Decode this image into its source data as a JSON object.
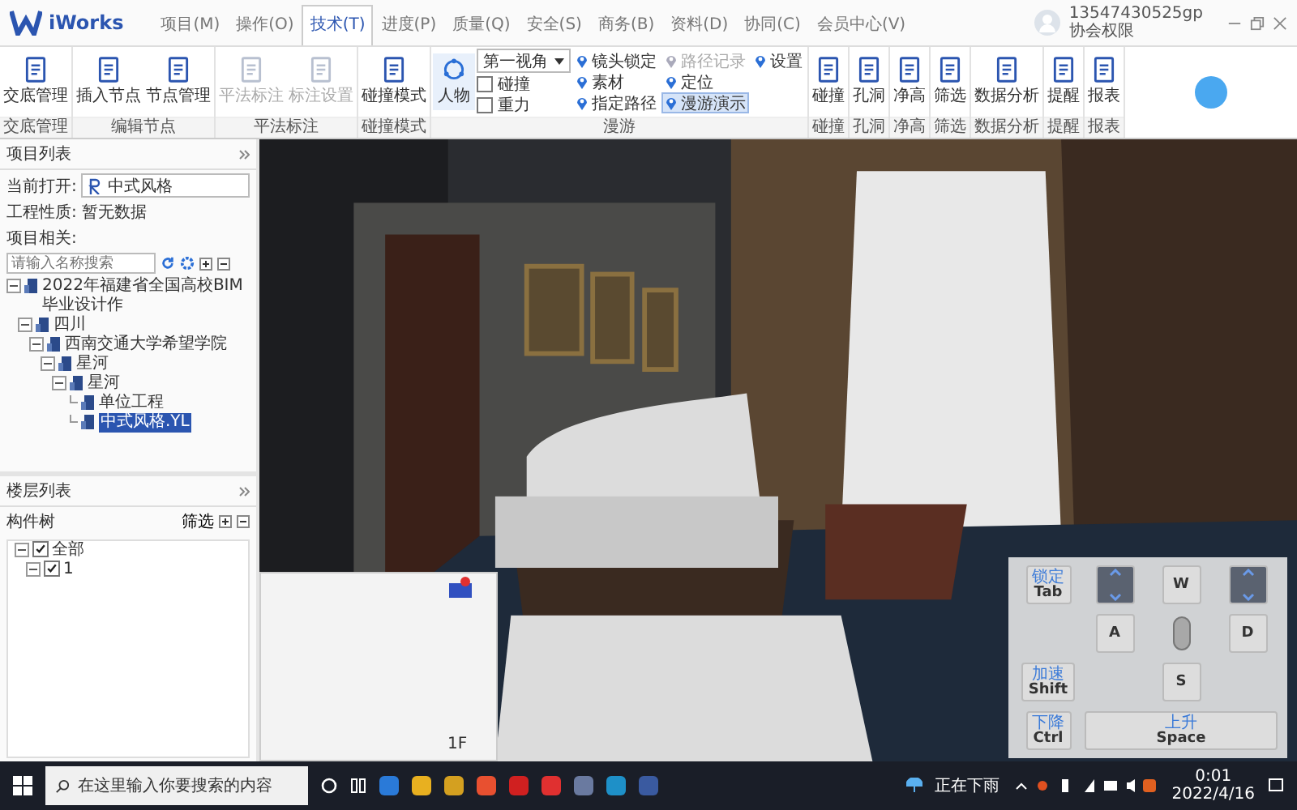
{
  "app": {
    "name": "iWorks"
  },
  "menu_tabs": [
    {
      "label": "项目(M)",
      "selected": false
    },
    {
      "label": "操作(O)",
      "selected": false
    },
    {
      "label": "技术(T)",
      "selected": true
    },
    {
      "label": "进度(P)",
      "selected": false
    },
    {
      "label": "质量(Q)",
      "selected": false
    },
    {
      "label": "安全(S)",
      "selected": false
    },
    {
      "label": "商务(B)",
      "selected": false
    },
    {
      "label": "资料(D)",
      "selected": false
    },
    {
      "label": "协同(C)",
      "selected": false
    },
    {
      "label": "会员中心(V)",
      "selected": false
    }
  ],
  "user": {
    "account": "13547430525gp",
    "role": "协会权限"
  },
  "ribbon_groups": [
    {
      "kind": "buttons",
      "label": "交底管理",
      "items": [
        {
          "label": "交底管理",
          "disabled": false
        }
      ]
    },
    {
      "kind": "buttons",
      "label": "编辑节点",
      "items": [
        {
          "label": "插入节点",
          "disabled": false
        },
        {
          "label": "节点管理",
          "disabled": false
        }
      ]
    },
    {
      "kind": "buttons",
      "label": "平法标注",
      "items": [
        {
          "label": "平法标注",
          "disabled": true
        },
        {
          "label": "标注设置",
          "disabled": true
        }
      ]
    },
    {
      "kind": "buttons",
      "label": "碰撞模式",
      "items": [
        {
          "label": "碰撞模式",
          "disabled": false
        }
      ]
    },
    {
      "kind": "roam",
      "label": "漫游",
      "person": "人物",
      "view_select": "第一视角",
      "checks": [
        {
          "label": "碰撞",
          "checked": false
        },
        {
          "label": "重力",
          "checked": false
        }
      ],
      "options": [
        {
          "label": "镜头锁定",
          "disabled": false,
          "selected": false
        },
        {
          "label": "素材",
          "disabled": false,
          "selected": false
        },
        {
          "label": "指定路径",
          "disabled": false,
          "selected": false
        },
        {
          "label": "路径记录",
          "disabled": true,
          "selected": false
        },
        {
          "label": "定位",
          "disabled": false,
          "selected": false
        },
        {
          "label": "漫游演示",
          "disabled": false,
          "selected": true
        },
        {
          "label": "设置",
          "disabled": false,
          "selected": false
        }
      ]
    },
    {
      "kind": "buttons",
      "label": "碰撞",
      "items": [
        {
          "label": "碰撞",
          "disabled": false
        }
      ]
    },
    {
      "kind": "buttons",
      "label": "孔洞",
      "items": [
        {
          "label": "孔洞",
          "disabled": false
        }
      ]
    },
    {
      "kind": "buttons",
      "label": "净高",
      "items": [
        {
          "label": "净高",
          "disabled": false
        }
      ]
    },
    {
      "kind": "buttons",
      "label": "筛选",
      "items": [
        {
          "label": "筛选",
          "disabled": false
        }
      ]
    },
    {
      "kind": "buttons",
      "label": "数据分析",
      "items": [
        {
          "label": "数据分析",
          "disabled": false
        }
      ]
    },
    {
      "kind": "buttons",
      "label": "提醒",
      "items": [
        {
          "label": "提醒",
          "disabled": false
        }
      ]
    },
    {
      "kind": "buttons",
      "label": "报表",
      "items": [
        {
          "label": "报表",
          "disabled": false
        }
      ]
    }
  ],
  "project_panel": {
    "title": "项目列表",
    "current_label": "当前打开:",
    "current_value": "中式风格",
    "nature_label": "工程性质:",
    "nature_value": "暂无数据",
    "related_label": "项目相关:",
    "search_placeholder": "请输入名称搜索",
    "tree": [
      {
        "label": "2022年福建省全国高校BIM毕业设计作",
        "expanded": true,
        "selected": false,
        "children": [
          {
            "label": "四川",
            "expanded": true,
            "selected": false,
            "children": [
              {
                "label": "西南交通大学希望学院",
                "expanded": true,
                "selected": false,
                "children": [
                  {
                    "label": "星河",
                    "expanded": true,
                    "selected": false,
                    "children": [
                      {
                        "label": "星河",
                        "expanded": true,
                        "selected": false,
                        "children": [
                          {
                            "label": "单位工程",
                            "selected": false
                          },
                          {
                            "label": "中式风格.YL",
                            "selected": true
                          }
                        ]
                      }
                    ]
                  }
                ]
              }
            ]
          }
        ]
      }
    ]
  },
  "floor_panel": {
    "title": "楼层列表",
    "tree_label": "构件树",
    "filter": "筛选",
    "tree": [
      {
        "label": "全部",
        "checked": true,
        "children": [
          {
            "label": "1",
            "checked": true
          }
        ]
      }
    ]
  },
  "viewport": {
    "floor_label": "1F"
  },
  "keypad": [
    {
      "kind": "key",
      "key": "Tab",
      "hint": "锁定"
    },
    {
      "kind": "icon"
    },
    {
      "kind": "key",
      "key": "W"
    },
    {
      "kind": "icon"
    },
    {
      "kind": "blank"
    },
    {
      "kind": "key",
      "key": "A"
    },
    {
      "kind": "mouse"
    },
    {
      "kind": "key",
      "key": "D"
    },
    {
      "kind": "key",
      "key": "Shift",
      "hint": "加速"
    },
    {
      "kind": "blank"
    },
    {
      "kind": "key",
      "key": "S"
    },
    {
      "kind": "blank"
    },
    {
      "kind": "key",
      "key": "Ctrl",
      "hint": "下降"
    },
    {
      "kind": "wide",
      "key": "Space",
      "hint": "上升"
    }
  ],
  "taskbar": {
    "search_placeholder": "在这里输入你要搜索的内容",
    "weather": "正在下雨",
    "time": "0:01",
    "date": "2022/4/16"
  }
}
